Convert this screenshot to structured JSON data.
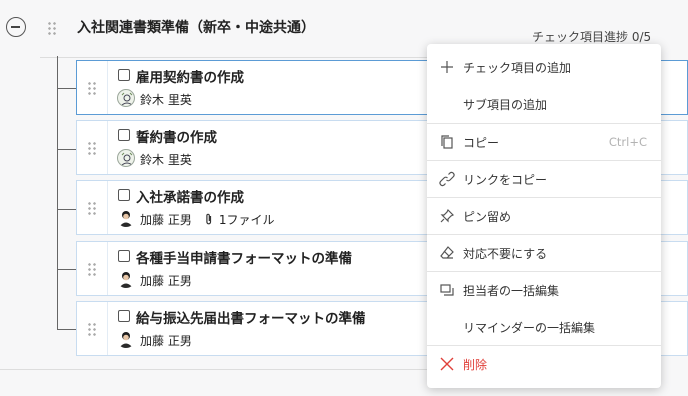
{
  "header": {
    "title": "入社関連書類準備（新卒・中途共通）",
    "progress": "チェック項目進捗 0/5"
  },
  "items": [
    {
      "name": "雇用契約書の作成",
      "assignee": "鈴木 里英",
      "avatar": "hand-drawn-avatar",
      "attachment": "",
      "selected": true
    },
    {
      "name": "誓約書の作成",
      "assignee": "鈴木 里英",
      "avatar": "hand-drawn-avatar",
      "attachment": ""
    },
    {
      "name": "入社承諾書の作成",
      "assignee": "加藤 正男",
      "avatar": "person-avatar",
      "attachment": "1ファイル"
    },
    {
      "name": "各種手当申請書フォーマットの準備",
      "assignee": "加藤 正男",
      "avatar": "person-avatar",
      "attachment": ""
    },
    {
      "name": "給与振込先届出書フォーマットの準備",
      "assignee": "加藤 正男",
      "avatar": "person-avatar",
      "attachment": ""
    }
  ],
  "menu": {
    "add_check_item": "チェック項目の追加",
    "add_sub_item": "サブ項目の追加",
    "copy": "コピー",
    "copy_shortcut": "Ctrl+C",
    "copy_link": "リンクをコピー",
    "pin": "ピン留め",
    "mark_not_needed": "対応不要にする",
    "bulk_edit_assignee": "担当者の一括編集",
    "bulk_edit_reminder": "リマインダーの一括編集",
    "delete": "削除"
  },
  "colors": {
    "danger": "#e0403a",
    "card_border": "#c8dcf0",
    "selected_border": "#5b9bd5"
  }
}
